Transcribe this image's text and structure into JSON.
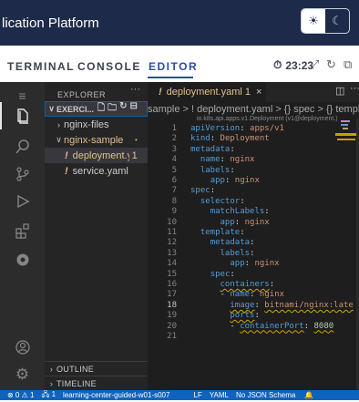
{
  "header": {
    "title": "lication Platform",
    "theme_light_icon": "sun-icon",
    "theme_dark_icon": "moon-icon"
  },
  "tabs": {
    "items": [
      {
        "label": "TERMINAL",
        "active": false
      },
      {
        "label": "CONSOLE",
        "active": false
      },
      {
        "label": "EDITOR",
        "active": true
      }
    ],
    "timer": "23:23"
  },
  "explorer": {
    "title": "EXPLORER",
    "more": "···",
    "workspace": "EXERCI...",
    "tree": [
      {
        "label": "nginx-files",
        "type": "folder",
        "expanded": false
      },
      {
        "label": "nginx-sample",
        "type": "folder",
        "expanded": true,
        "modified": "•"
      },
      {
        "label": "deployment.ya...",
        "type": "yaml",
        "badge": "1"
      },
      {
        "label": "service.yaml",
        "type": "yaml"
      }
    ],
    "outline": "OUTLINE",
    "timeline": "TIMELINE"
  },
  "editor": {
    "tab_label": "deployment.yaml",
    "tab_badge": "1",
    "tab_close": "×",
    "breadcrumbs": "sample > ! deployment.yaml > {} spec > {} template > ",
    "schema_hint": "io.k8s.api.apps.v1.Deployment (v1@deployment.)",
    "lines": [
      {
        "n": "1",
        "parts": [
          [
            "k",
            "apiVersion"
          ],
          [
            "p",
            ": "
          ],
          [
            "v",
            "apps/v1"
          ]
        ]
      },
      {
        "n": "2",
        "parts": [
          [
            "k",
            "kind"
          ],
          [
            "p",
            ": "
          ],
          [
            "v",
            "Deployment"
          ]
        ]
      },
      {
        "n": "3",
        "parts": [
          [
            "k",
            "metadata"
          ],
          [
            "p",
            ":"
          ]
        ]
      },
      {
        "n": "4",
        "parts": [
          [
            "p",
            "  "
          ],
          [
            "k",
            "name"
          ],
          [
            "p",
            ": "
          ],
          [
            "v",
            "nginx"
          ]
        ]
      },
      {
        "n": "5",
        "parts": [
          [
            "p",
            "  "
          ],
          [
            "k",
            "labels"
          ],
          [
            "p",
            ":"
          ]
        ]
      },
      {
        "n": "6",
        "parts": [
          [
            "p",
            "    "
          ],
          [
            "k",
            "app"
          ],
          [
            "p",
            ": "
          ],
          [
            "v",
            "nginx"
          ]
        ]
      },
      {
        "n": "7",
        "parts": [
          [
            "k",
            "spec"
          ],
          [
            "p",
            ":"
          ]
        ]
      },
      {
        "n": "8",
        "parts": [
          [
            "p",
            "  "
          ],
          [
            "k",
            "selector"
          ],
          [
            "p",
            ":"
          ]
        ]
      },
      {
        "n": "9",
        "parts": [
          [
            "p",
            "    "
          ],
          [
            "k",
            "matchLabels"
          ],
          [
            "p",
            ":"
          ]
        ]
      },
      {
        "n": "10",
        "parts": [
          [
            "p",
            "      "
          ],
          [
            "k",
            "app"
          ],
          [
            "p",
            ": "
          ],
          [
            "v",
            "nginx"
          ]
        ]
      },
      {
        "n": "11",
        "parts": [
          [
            "p",
            "  "
          ],
          [
            "k",
            "template"
          ],
          [
            "p",
            ":"
          ]
        ]
      },
      {
        "n": "12",
        "parts": [
          [
            "p",
            "    "
          ],
          [
            "k",
            "metadata"
          ],
          [
            "p",
            ":"
          ]
        ]
      },
      {
        "n": "13",
        "parts": [
          [
            "p",
            "      "
          ],
          [
            "k",
            "labels"
          ],
          [
            "p",
            ":"
          ]
        ]
      },
      {
        "n": "14",
        "parts": [
          [
            "p",
            "        "
          ],
          [
            "k",
            "app"
          ],
          [
            "p",
            ": "
          ],
          [
            "v",
            "nginx"
          ]
        ]
      },
      {
        "n": "15",
        "parts": [
          [
            "p",
            "    "
          ],
          [
            "k",
            "spec"
          ],
          [
            "p",
            ":"
          ]
        ]
      },
      {
        "n": "16",
        "parts": [
          [
            "p",
            "      "
          ],
          [
            "k",
            "containers",
            "sq"
          ],
          [
            "p",
            ":"
          ]
        ]
      },
      {
        "n": "17",
        "parts": [
          [
            "p",
            "      - "
          ],
          [
            "k",
            "name"
          ],
          [
            "p",
            ": "
          ],
          [
            "v",
            "nginx"
          ]
        ]
      },
      {
        "n": "18",
        "parts": [
          [
            "p",
            "        "
          ],
          [
            "k",
            "image"
          ],
          [
            "p",
            ": "
          ],
          [
            "v",
            "bitnami/nginx:late"
          ]
        ],
        "current": true,
        "squig": true
      },
      {
        "n": "19",
        "parts": [
          [
            "p",
            "        "
          ],
          [
            "k",
            "ports"
          ],
          [
            "p",
            ":"
          ]
        ],
        "squig": true
      },
      {
        "n": "20",
        "parts": [
          [
            "p",
            "        - "
          ],
          [
            "k",
            "containerPort"
          ],
          [
            "p",
            ": "
          ],
          [
            "n",
            "8080"
          ]
        ],
        "squig": true
      },
      {
        "n": "21",
        "parts": []
      }
    ]
  },
  "statusbar": {
    "problems": "⊗ 0 ⚠ 1",
    "ports": "🖧 1",
    "workspace": "learning-center-guided-w01-s007",
    "eol": "LF",
    "language": "YAML",
    "schema": "No JSON Schema",
    "bell": "🔔"
  },
  "colors": {
    "header_bg": "#1e2a4a",
    "accent": "#2a4ea8",
    "status_bg": "#0e63bd"
  }
}
